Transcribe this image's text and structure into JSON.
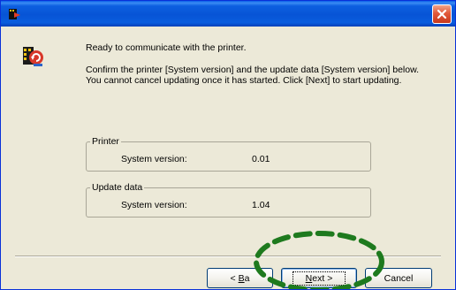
{
  "window": {
    "title": "",
    "close_icon": "close-icon"
  },
  "message": {
    "line1": "Ready to communicate with the printer.",
    "line2": "Confirm the printer [System version] and the update data [System version] below.",
    "line3": "You cannot cancel updating once it has started. Click [Next] to start updating."
  },
  "printer": {
    "legend": "Printer",
    "label": "System version:",
    "value": "0.01"
  },
  "update_data": {
    "legend": "Update data",
    "label": "System version:",
    "value": "1.04"
  },
  "buttons": {
    "back_prefix": "< ",
    "back_key": "B",
    "back_suffix": "a",
    "next_key": "N",
    "next_suffix": "ext >",
    "cancel": "Cancel"
  },
  "colors": {
    "titlebar": "#0a5dde",
    "face": "#ece9d8",
    "highlight": "#1e7a1e"
  }
}
